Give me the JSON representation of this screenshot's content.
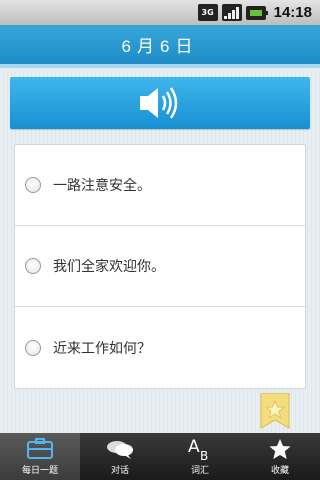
{
  "status": {
    "network_type": "3G",
    "time": "14:18"
  },
  "header": {
    "title": "6月6日"
  },
  "audio": {
    "icon": "speaker-icon"
  },
  "options": [
    {
      "label": "一路注意安全。"
    },
    {
      "label": "我们全家欢迎你。"
    },
    {
      "label": "近来工作如何？"
    }
  ],
  "bookmark": {
    "icon": "star-bookmark-icon"
  },
  "nav": {
    "items": [
      {
        "label": "每日一题",
        "icon": "daily-icon",
        "active": true
      },
      {
        "label": "对话",
        "icon": "chat-icon",
        "active": false
      },
      {
        "label": "词汇",
        "icon": "vocab-icon",
        "active": false
      },
      {
        "label": "收藏",
        "icon": "star-icon",
        "active": false
      }
    ]
  },
  "colors": {
    "header_blue": "#1e8cc7",
    "audio_blue": "#2aa3e0",
    "nav_dark": "#2a2a2a"
  }
}
